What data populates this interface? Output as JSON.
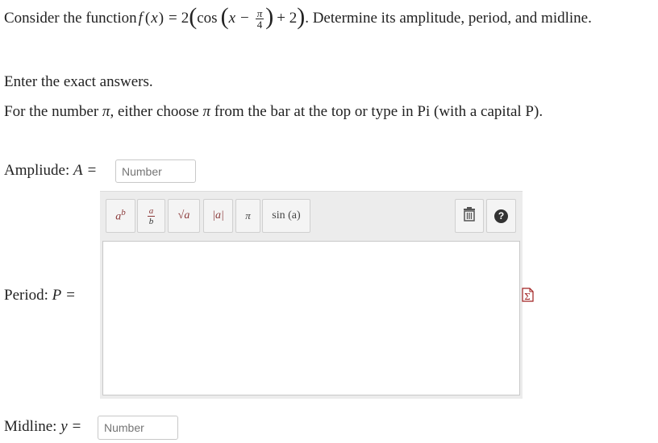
{
  "question": {
    "intro": "Consider the function ",
    "func_name": "f",
    "func_var": "x",
    "eq": "=",
    "coef": "2",
    "cos": "cos",
    "minus": "−",
    "pi": "π",
    "four": "4",
    "plus2": "+ 2",
    "outro": ". Determine its amplitude, period, and midline."
  },
  "instructions": {
    "line1": "Enter the exact answers.",
    "line2_pre": "For the number ",
    "line2_mid": ", either choose ",
    "line2_post": " from the bar at the top or type in Pi (with a capital P).",
    "pi": "π"
  },
  "amplitude": {
    "label": "Ampliude: ",
    "var": "A",
    "eq": "=",
    "placeholder": "Number"
  },
  "period": {
    "label": "Period: ",
    "var": "P",
    "eq": "="
  },
  "midline": {
    "label": "Midline: ",
    "var": "y",
    "eq": "=",
    "placeholder": "Number"
  },
  "toolbar": {
    "buttons": [
      {
        "name": "superscript",
        "icon": "superscript-icon"
      },
      {
        "name": "fraction",
        "icon": "fraction-icon"
      },
      {
        "name": "sqrt",
        "icon": "sqrt-icon",
        "label": "√a"
      },
      {
        "name": "abs",
        "icon": "abs-icon",
        "label": "|a|"
      },
      {
        "name": "pi",
        "icon": "pi-icon",
        "label": "π"
      },
      {
        "name": "sin",
        "icon": "sin-icon",
        "label": "sin (a)"
      }
    ],
    "right_buttons": [
      {
        "name": "trash",
        "icon": "trash-icon"
      },
      {
        "name": "help",
        "icon": "help-icon",
        "label": "?"
      }
    ]
  },
  "colors": {
    "accent": "#8b3a3a",
    "toolbar_bg": "#ececec"
  }
}
